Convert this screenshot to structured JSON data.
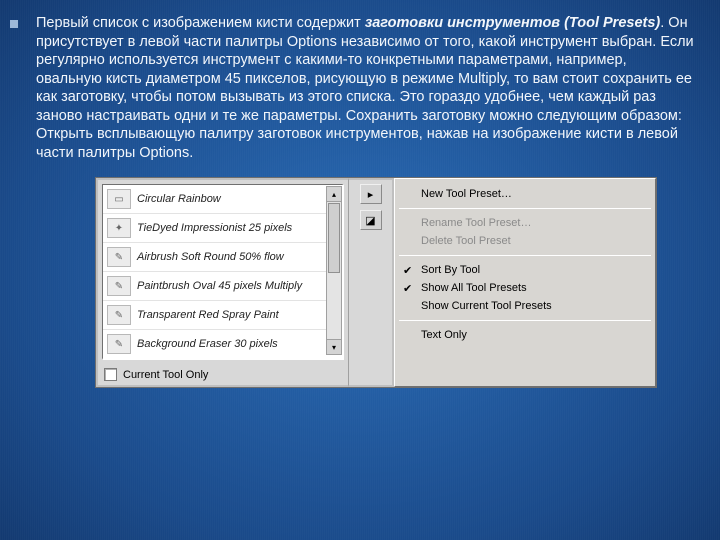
{
  "paragraph": {
    "pre": "Первый список с изображением кисти содержит ",
    "bold": "заготовки инструментов (Tool Presets)",
    "post": ". Он присутствует в левой части палитры Options независимо от того, какой инструмент выбран. Если регулярно используется инструмент с какими-то конкретными параметрами, например, овальную кисть диаметром 45 пикселов, рисующую в режиме Multiply, то вам стоит сохранить ее как заготовку, чтобы потом вызывать из этого списка. Это гораздо удобнее, чем каждый раз заново настраивать одни и те же параметры. Сохранить заготовку можно следующим образом: Открыть всплывающую палитру заготовок инструментов, нажав на изображение кисти в левой части палитры Options."
  },
  "presets": {
    "items": [
      {
        "icon": "▭",
        "label": "Circular Rainbow"
      },
      {
        "icon": "✦",
        "label": "TieDyed Impressionist 25 pixels"
      },
      {
        "icon": "✎",
        "label": "Airbrush Soft Round 50% flow"
      },
      {
        "icon": "✎",
        "label": "Paintbrush Oval 45 pixels Multiply"
      },
      {
        "icon": "✎",
        "label": "Transparent Red Spray Paint"
      },
      {
        "icon": "✎",
        "label": "Background Eraser 30 pixels"
      }
    ],
    "toolOnly": "Current Tool Only"
  },
  "midButtons": {
    "play": "▸",
    "new": "◪"
  },
  "menu": {
    "new": "New Tool Preset…",
    "rename": "Rename Tool Preset…",
    "delete": "Delete Tool Preset",
    "sort": "Sort By Tool",
    "showAll": "Show All Tool Presets",
    "showCurrent": "Show Current Tool Presets",
    "textOnly": "Text Only"
  }
}
